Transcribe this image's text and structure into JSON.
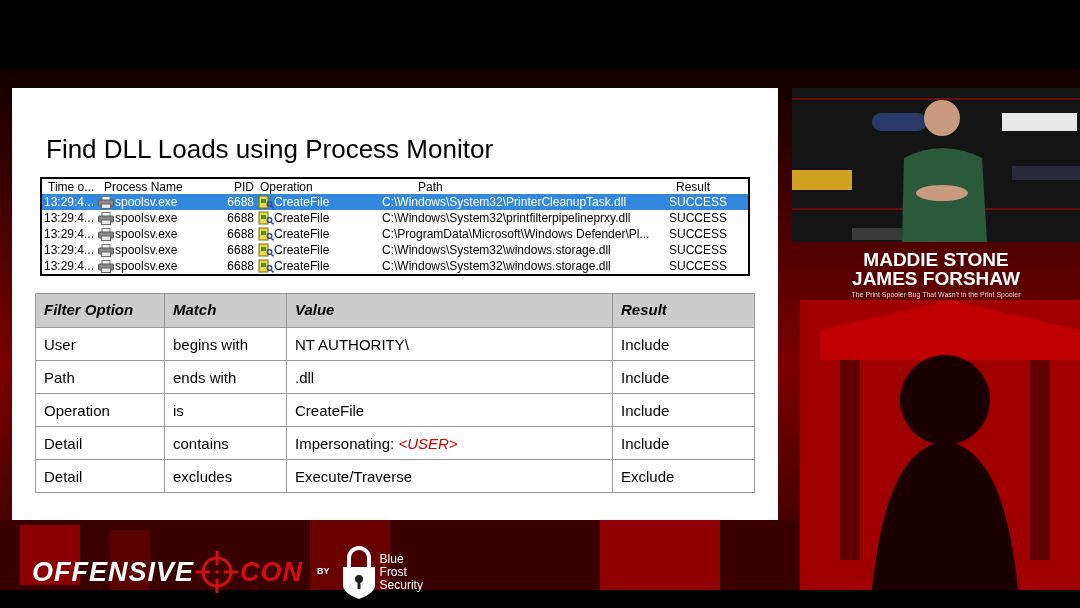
{
  "slide": {
    "title": "Find DLL Loads using Process Monitor",
    "procmon": {
      "columns": [
        "Time o...",
        "Process Name",
        "PID",
        "Operation",
        "Path",
        "Result"
      ],
      "rows": [
        {
          "time": "13:29:4...",
          "process": "spoolsv.exe",
          "pid": "6688",
          "operation": "CreateFile",
          "path": "C:\\Windows\\System32\\PrinterCleanupTask.dll",
          "result": "SUCCESS",
          "selected": true
        },
        {
          "time": "13:29:4...",
          "process": "spoolsv.exe",
          "pid": "6688",
          "operation": "CreateFile",
          "path": "C:\\Windows\\System32\\printfilterpipelineprxy.dll",
          "result": "SUCCESS",
          "selected": false
        },
        {
          "time": "13:29:4...",
          "process": "spoolsv.exe",
          "pid": "6688",
          "operation": "CreateFile",
          "path": "C:\\ProgramData\\Microsoft\\Windows Defender\\Pl...",
          "result": "SUCCESS",
          "selected": false
        },
        {
          "time": "13:29:4...",
          "process": "spoolsv.exe",
          "pid": "6688",
          "operation": "CreateFile",
          "path": "C:\\Windows\\System32\\windows.storage.dll",
          "result": "SUCCESS",
          "selected": false
        },
        {
          "time": "13:29:4...",
          "process": "spoolsv.exe",
          "pid": "6688",
          "operation": "CreateFile",
          "path": "C:\\Windows\\System32\\windows.storage.dll",
          "result": "SUCCESS",
          "selected": false
        }
      ]
    },
    "filter_table": {
      "columns": [
        "Filter Option",
        "Match",
        "Value",
        "Result"
      ],
      "rows": [
        {
          "filter_option": "User",
          "match": "begins with",
          "value": "NT AUTHORITY\\",
          "result": "Include"
        },
        {
          "filter_option": "Path",
          "match": "ends with",
          "value": ".dll",
          "result": "Include"
        },
        {
          "filter_option": "Operation",
          "match": "is",
          "value": "CreateFile",
          "result": "Include"
        },
        {
          "filter_option": "Detail",
          "match": "contains",
          "value": "Impersonating: *<USER>*",
          "result": "Include"
        },
        {
          "filter_option": "Detail",
          "match": "excludes",
          "value": "Execute/Traverse",
          "result": "Exclude"
        }
      ]
    }
  },
  "speakers": [
    "MADDIE STONE",
    "JAMES FORSHAW"
  ],
  "talk_title": "The Print Spooler Bug That Wasn't in the Print Spooler",
  "footer": {
    "logo_left": "OFFENSIVE",
    "logo_right": "CON",
    "by": "BY",
    "sponsor_lines": [
      "Blue",
      "Frost",
      "Security"
    ]
  }
}
